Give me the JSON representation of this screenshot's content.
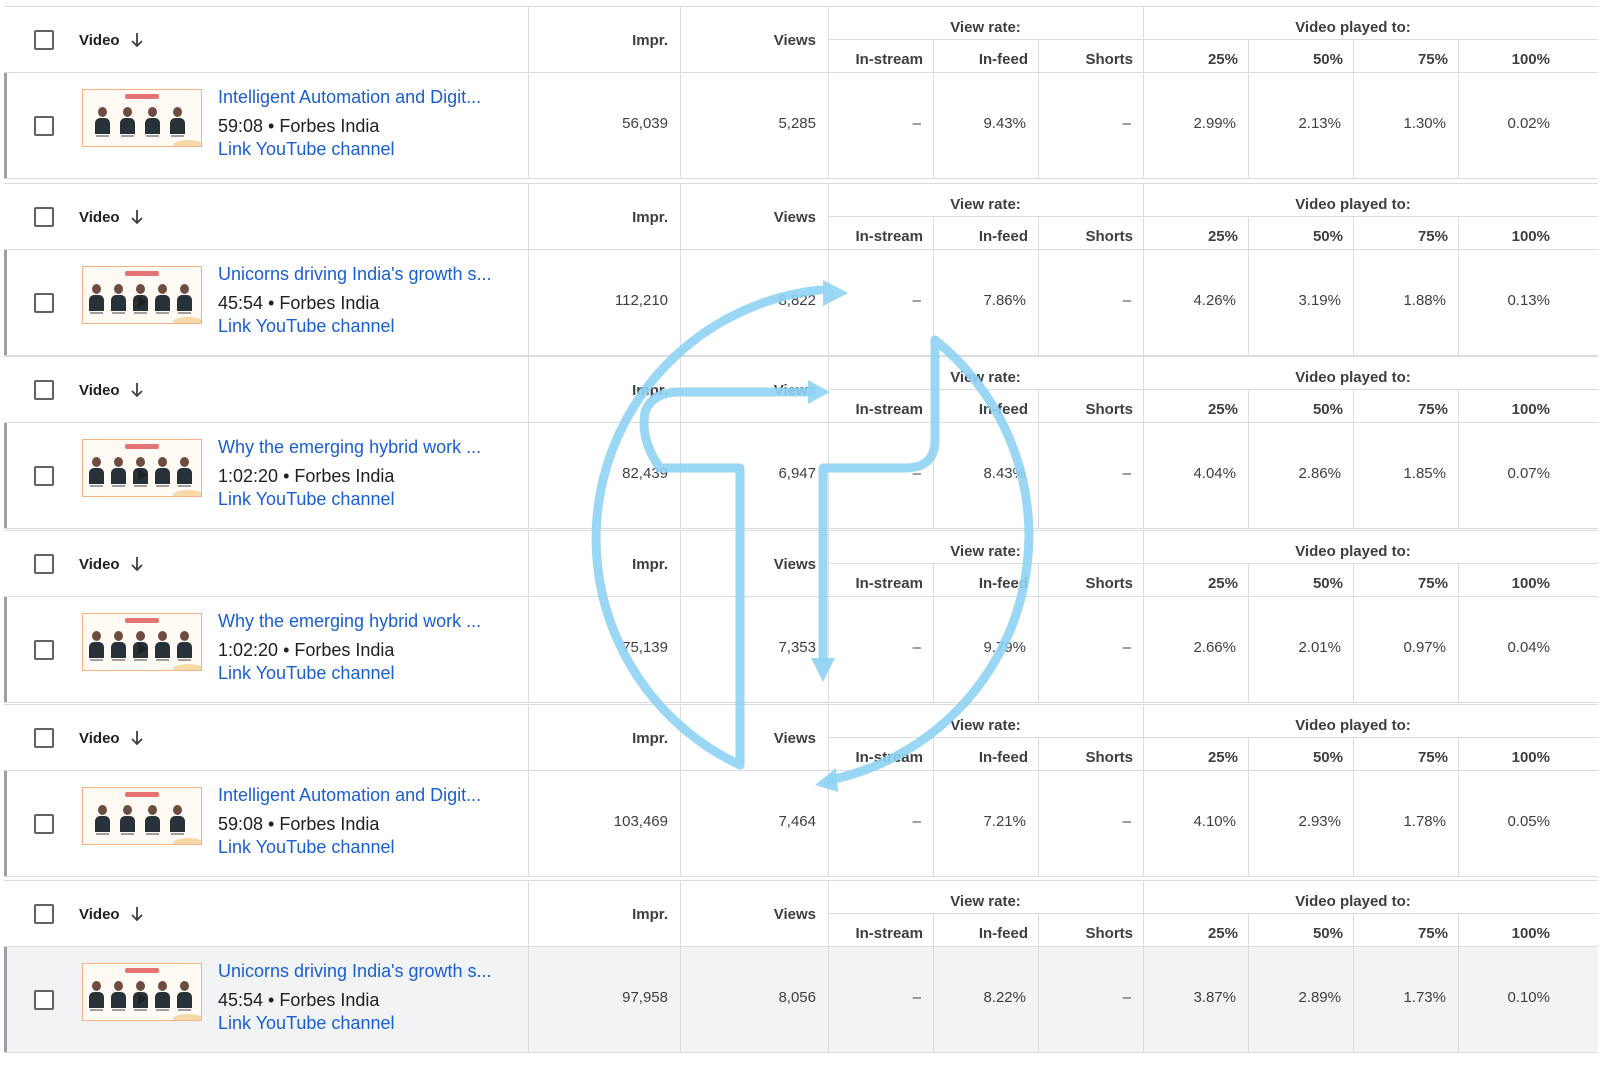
{
  "header": {
    "video": "Video",
    "impr": "Impr.",
    "views": "Views",
    "view_rate": "View rate:",
    "video_played": "Video played to:",
    "in_stream": "In-stream",
    "in_feed": "In-feed",
    "shorts": "Shorts",
    "p25": "25%",
    "p50": "50%",
    "p75": "75%",
    "p100": "100%"
  },
  "link_label": "Link YouTube channel",
  "rows": [
    {
      "title": "Intelligent Automation and Digit...",
      "duration": "59:08",
      "channel": "Forbes India",
      "impr": "56,039",
      "views": "5,285",
      "instream": "–",
      "infeed": "9.43%",
      "shorts": "–",
      "p25": "2.99%",
      "p50": "2.13%",
      "p75": "1.30%",
      "p100": "0.02%",
      "thumb": "four-panelists"
    },
    {
      "title": "Unicorns driving India's growth s...",
      "duration": "45:54",
      "channel": "Forbes India",
      "impr": "112,210",
      "views": "8,822",
      "instream": "–",
      "infeed": "7.86%",
      "shorts": "–",
      "p25": "4.26%",
      "p50": "3.19%",
      "p75": "1.88%",
      "p100": "0.13%",
      "thumb": "five-panelists"
    },
    {
      "title": "Why the emerging hybrid work ...",
      "duration": "1:02:20",
      "channel": "Forbes India",
      "impr": "82,439",
      "views": "6,947",
      "instream": "–",
      "infeed": "8.43%",
      "shorts": "–",
      "p25": "4.04%",
      "p50": "2.86%",
      "p75": "1.85%",
      "p100": "0.07%",
      "thumb": "five-panelists"
    },
    {
      "title": "Why the emerging hybrid work ...",
      "duration": "1:02:20",
      "channel": "Forbes India",
      "impr": "75,139",
      "views": "7,353",
      "instream": "–",
      "infeed": "9.79%",
      "shorts": "–",
      "p25": "2.66%",
      "p50": "2.01%",
      "p75": "0.97%",
      "p100": "0.04%",
      "thumb": "five-panelists"
    },
    {
      "title": "Intelligent Automation and Digit...",
      "duration": "59:08",
      "channel": "Forbes India",
      "impr": "103,469",
      "views": "7,464",
      "instream": "–",
      "infeed": "7.21%",
      "shorts": "–",
      "p25": "4.10%",
      "p50": "2.93%",
      "p75": "1.78%",
      "p100": "0.05%",
      "thumb": "four-panelists"
    },
    {
      "title": "Unicorns driving India's growth s...",
      "duration": "45:54",
      "channel": "Forbes India",
      "impr": "97,958",
      "views": "8,056",
      "instream": "–",
      "infeed": "8.22%",
      "shorts": "–",
      "p25": "3.87%",
      "p50": "2.89%",
      "p75": "1.73%",
      "p100": "0.10%",
      "thumb": "five-panelists"
    }
  ],
  "icons": {
    "sort": "arrow-down-icon",
    "checkbox": "checkbox-icon",
    "overlay": "transfer-logo-icon"
  },
  "colors": {
    "link": "#1a5fd0",
    "overlay": "#8fd3f4",
    "grid": "#dadce0"
  }
}
